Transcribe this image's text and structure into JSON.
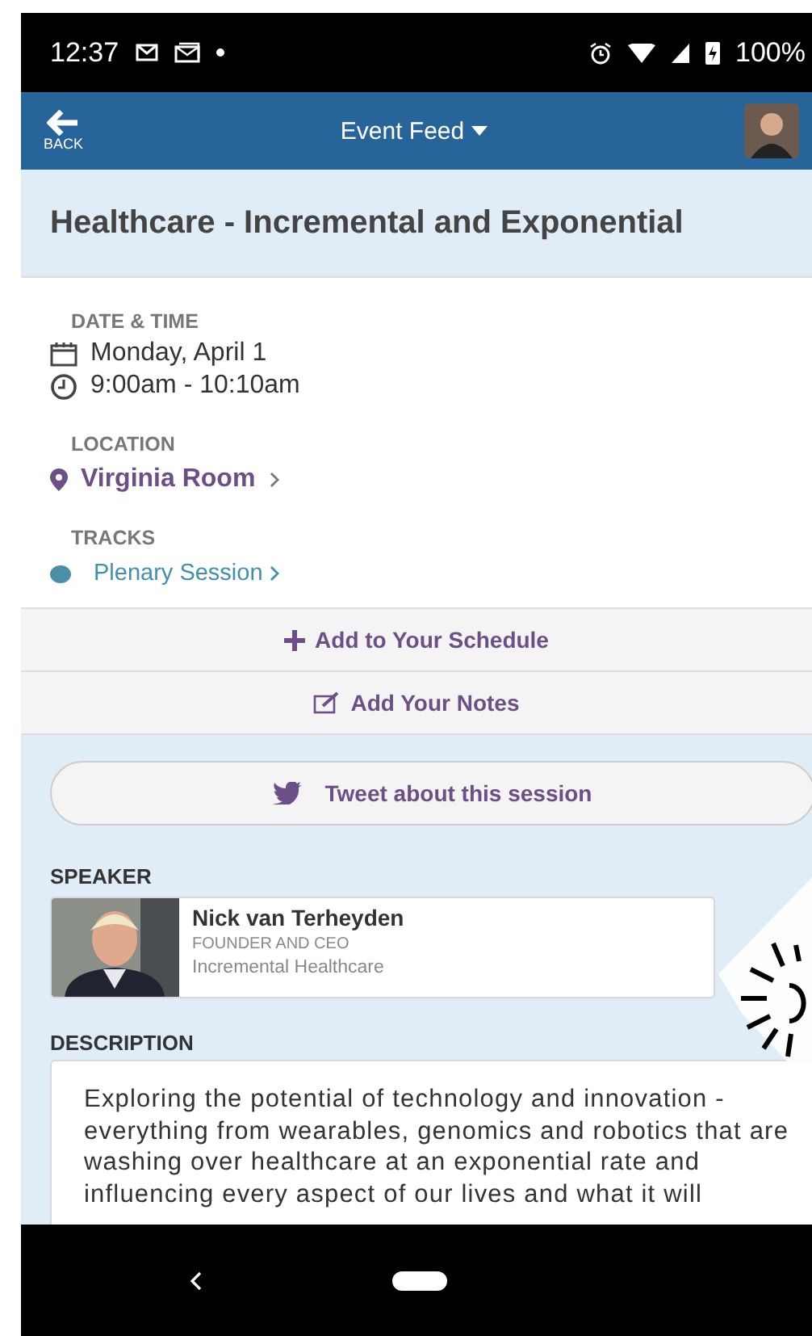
{
  "status_bar": {
    "time": "12:37",
    "battery": "100%"
  },
  "header": {
    "back_label": "BACK",
    "title": "Event Feed"
  },
  "session": {
    "title": "Healthcare - Incremental and Exponential",
    "date_label": "DATE & TIME",
    "date": "Monday, April 1",
    "time": "9:00am - 10:10am",
    "location_label": "LOCATION",
    "location": "Virginia Room",
    "tracks_label": "TRACKS",
    "tracks": [
      {
        "name": "Plenary Session",
        "color": "#4a8fa8"
      }
    ]
  },
  "actions": [
    {
      "kind": "plus",
      "label": "Add to Your Schedule"
    },
    {
      "kind": "note",
      "label": "Add Your Notes"
    }
  ],
  "tweet": {
    "label": "Tweet about this session"
  },
  "speaker_label": "SPEAKER",
  "speaker": {
    "name": "Nick van Terheyden",
    "role": "FOUNDER AND CEO",
    "company": "Incremental Healthcare"
  },
  "description_label": "DESCRIPTION",
  "description": "Exploring the potential of technology and innovation - everything from wearables, genomics and robotics that are washing over healthcare at an exponential rate and influencing every aspect of our lives and what it will"
}
